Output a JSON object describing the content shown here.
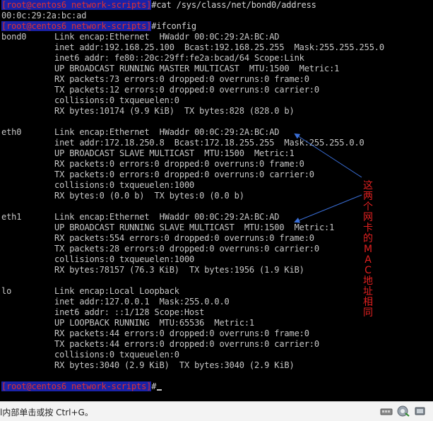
{
  "terminal": {
    "lines": [
      {
        "prompt": "[root@centos6 network-scripts]",
        "cmd": "#cat /sys/class/net/bond0/address"
      },
      {
        "text": "00:0c:29:2a:bc:ad"
      },
      {
        "prompt": "[root@centos6 network-scripts]",
        "cmd": "#ifconfig"
      },
      {
        "iface": "bond0",
        "text": "Link encap:Ethernet  HWaddr 00:0C:29:2A:BC:AD"
      },
      {
        "text": "inet addr:192.168.25.100  Bcast:192.168.25.255  Mask:255.255.255.0"
      },
      {
        "text": "inet6 addr: fe80::20c:29ff:fe2a:bcad/64 Scope:Link"
      },
      {
        "text": "UP BROADCAST RUNNING MASTER MULTICAST  MTU:1500  Metric:1"
      },
      {
        "text": "RX packets:73 errors:0 dropped:0 overruns:0 frame:0"
      },
      {
        "text": "TX packets:12 errors:0 dropped:0 overruns:0 carrier:0"
      },
      {
        "text": "collisions:0 txqueuelen:0"
      },
      {
        "text": "RX bytes:10174 (9.9 KiB)  TX bytes:828 (828.0 b)"
      },
      {
        "text": ""
      },
      {
        "iface": "eth0",
        "text": "Link encap:Ethernet  HWaddr 00:0C:29:2A:BC:AD"
      },
      {
        "text": "inet addr:172.18.250.8  Bcast:172.18.255.255  Mask:255.255.0.0"
      },
      {
        "text": "UP BROADCAST SLAVE MULTICAST  MTU:1500  Metric:1"
      },
      {
        "text": "RX packets:0 errors:0 dropped:0 overruns:0 frame:0"
      },
      {
        "text": "TX packets:0 errors:0 dropped:0 overruns:0 carrier:0"
      },
      {
        "text": "collisions:0 txqueuelen:1000"
      },
      {
        "text": "RX bytes:0 (0.0 b)  TX bytes:0 (0.0 b)"
      },
      {
        "text": ""
      },
      {
        "iface": "eth1",
        "text": "Link encap:Ethernet  HWaddr 00:0C:29:2A:BC:AD"
      },
      {
        "text": "UP BROADCAST RUNNING SLAVE MULTICAST  MTU:1500  Metric:1"
      },
      {
        "text": "RX packets:554 errors:0 dropped:0 overruns:0 frame:0"
      },
      {
        "text": "TX packets:28 errors:0 dropped:0 overruns:0 carrier:0"
      },
      {
        "text": "collisions:0 txqueuelen:1000"
      },
      {
        "text": "RX bytes:78157 (76.3 KiB)  TX bytes:1956 (1.9 KiB)"
      },
      {
        "text": ""
      },
      {
        "iface": "lo",
        "text": "Link encap:Local Loopback"
      },
      {
        "text": "inet addr:127.0.0.1  Mask:255.0.0.0"
      },
      {
        "text": "inet6 addr: ::1/128 Scope:Host"
      },
      {
        "text": "UP LOOPBACK RUNNING  MTU:65536  Metric:1"
      },
      {
        "text": "RX packets:44 errors:0 dropped:0 overruns:0 frame:0"
      },
      {
        "text": "TX packets:44 errors:0 dropped:0 overruns:0 carrier:0"
      },
      {
        "text": "collisions:0 txqueuelen:0"
      },
      {
        "text": "RX bytes:3040 (2.9 KiB)  TX bytes:3040 (2.9 KiB)"
      },
      {
        "text": ""
      },
      {
        "prompt": "[root@centos6 network-scripts]",
        "cmd": "#",
        "cursor": true
      }
    ]
  },
  "annotation": {
    "text": "这两个网卡的MAC地址相同",
    "color": "#e02020",
    "arrow_color": "#3a6fd8"
  },
  "status_bar": {
    "text": "l内部单击或按 Ctrl+G。",
    "icons": [
      "network-adapter-icon",
      "sound-icon",
      "usb-device-icon"
    ]
  }
}
